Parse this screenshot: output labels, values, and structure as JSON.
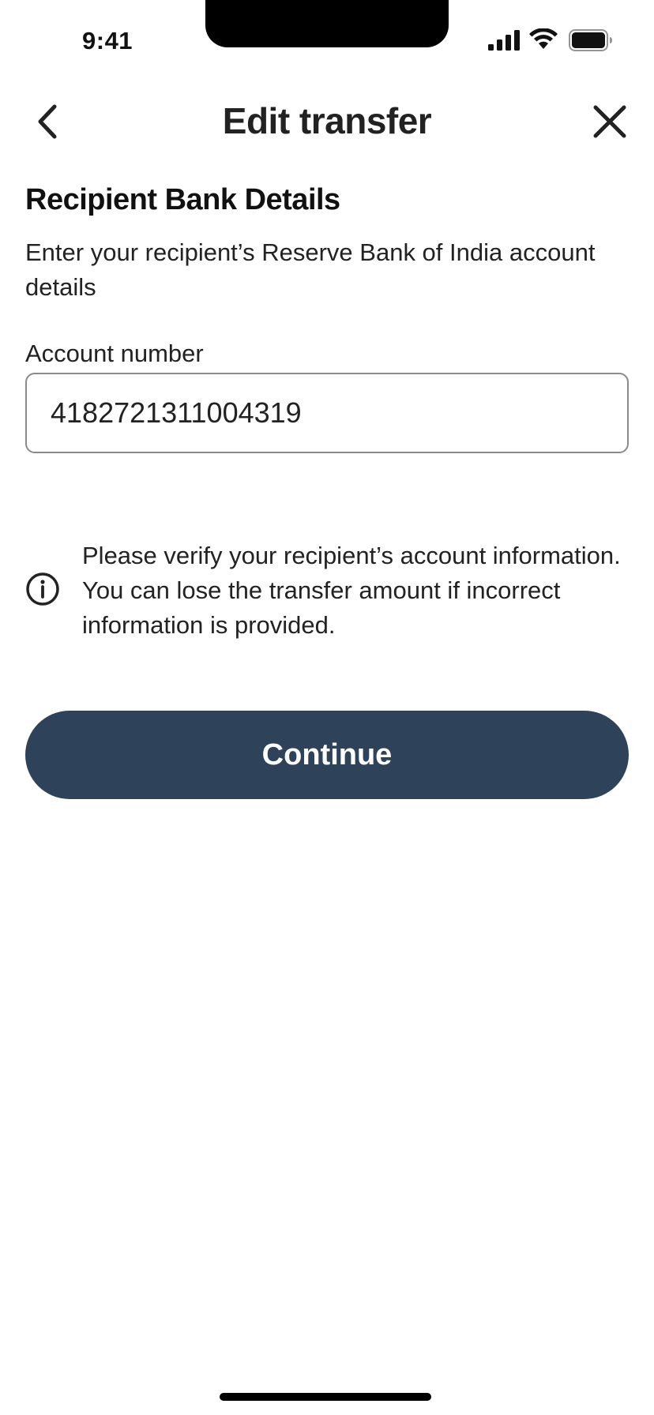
{
  "status_bar": {
    "time": "9:41"
  },
  "header": {
    "title": "Edit transfer",
    "back_icon": "chevron-left-icon",
    "close_icon": "close-icon"
  },
  "recipient": {
    "heading": "Recipient Bank Details",
    "description": "Enter your recipient’s Reserve Bank of India account details"
  },
  "account_field": {
    "label": "Account number",
    "value": "4182721311004319"
  },
  "notice": {
    "icon": "info-icon",
    "text": "Please verify your recipient’s account information. You can lose the transfer amount if incorrect information is provided."
  },
  "actions": {
    "continue_label": "Continue"
  },
  "colors": {
    "primary_button": "#2e425a"
  }
}
